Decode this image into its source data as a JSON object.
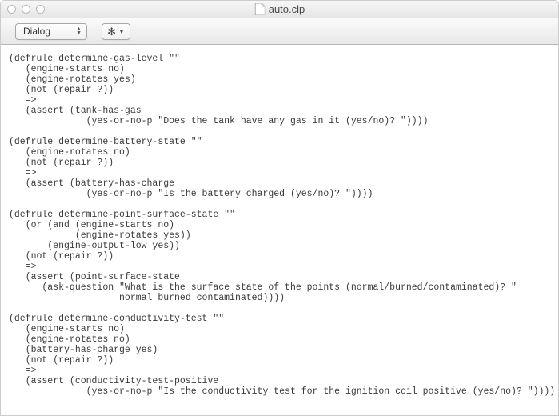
{
  "window": {
    "title": "auto.clp"
  },
  "toolbar": {
    "dropdown_label": "Dialog"
  },
  "editor": {
    "content": "(defrule determine-gas-level \"\"\n   (engine-starts no)\n   (engine-rotates yes)\n   (not (repair ?))\n   =>\n   (assert (tank-has-gas\n              (yes-or-no-p \"Does the tank have any gas in it (yes/no)? \"))))\n\n(defrule determine-battery-state \"\"\n   (engine-rotates no)\n   (not (repair ?))\n   =>\n   (assert (battery-has-charge\n              (yes-or-no-p \"Is the battery charged (yes/no)? \"))))\n\n(defrule determine-point-surface-state \"\"\n   (or (and (engine-starts no)\n            (engine-rotates yes))\n       (engine-output-low yes))\n   (not (repair ?))\n   =>\n   (assert (point-surface-state\n      (ask-question \"What is the surface state of the points (normal/burned/contaminated)? \"\n                    normal burned contaminated))))\n\n(defrule determine-conductivity-test \"\"\n   (engine-starts no)\n   (engine-rotates no)\n   (battery-has-charge yes)\n   (not (repair ?))\n   =>\n   (assert (conductivity-test-positive\n              (yes-or-no-p \"Is the conductivity test for the ignition coil positive (yes/no)? \"))))"
  }
}
